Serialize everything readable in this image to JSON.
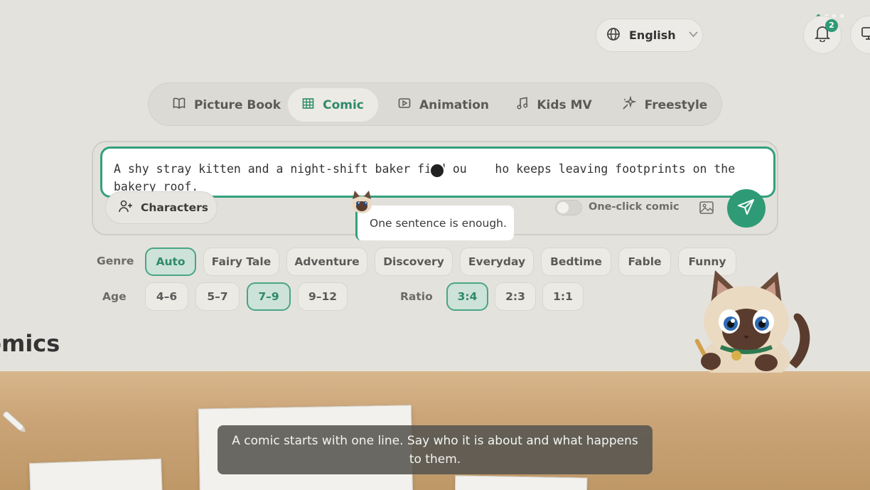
{
  "header": {
    "language": "English",
    "notification_count": "2",
    "colors": {
      "accent": "#2e9b76"
    }
  },
  "tabs": [
    {
      "label": "Picture Book",
      "icon": "book-icon",
      "active": false
    },
    {
      "label": "Comic",
      "icon": "grid-icon",
      "active": true
    },
    {
      "label": "Animation",
      "icon": "play-icon",
      "active": false
    },
    {
      "label": "Kids MV",
      "icon": "music-note-icon",
      "active": false
    },
    {
      "label": "Freestyle",
      "icon": "sparkle-icon",
      "active": false
    }
  ],
  "prompt": {
    "text": "A shy stray kitten and a night-shift baker find ou    ho keeps leaving footprints on the bakery roof.",
    "characters_label": "Characters",
    "one_click_label": "One-click comic",
    "one_click_on": false
  },
  "tooltip": {
    "text": "One sentence is enough."
  },
  "filters": {
    "genre_label": "Genre",
    "genres": [
      "Auto",
      "Fairy Tale",
      "Adventure",
      "Discovery",
      "Everyday",
      "Bedtime",
      "Fable",
      "Funny"
    ],
    "genre_selected": "Auto",
    "age_label": "Age",
    "ages": [
      "4–6",
      "5–7",
      "7–9",
      "9–12"
    ],
    "age_selected": "7–9",
    "ratio_label": "Ratio",
    "ratios": [
      "3:4",
      "2:3",
      "1:1"
    ],
    "ratio_selected": "3:4"
  },
  "section": {
    "title": "omics"
  },
  "caption": {
    "text": "A comic starts with one line. Say who it is about and what happens to them."
  }
}
